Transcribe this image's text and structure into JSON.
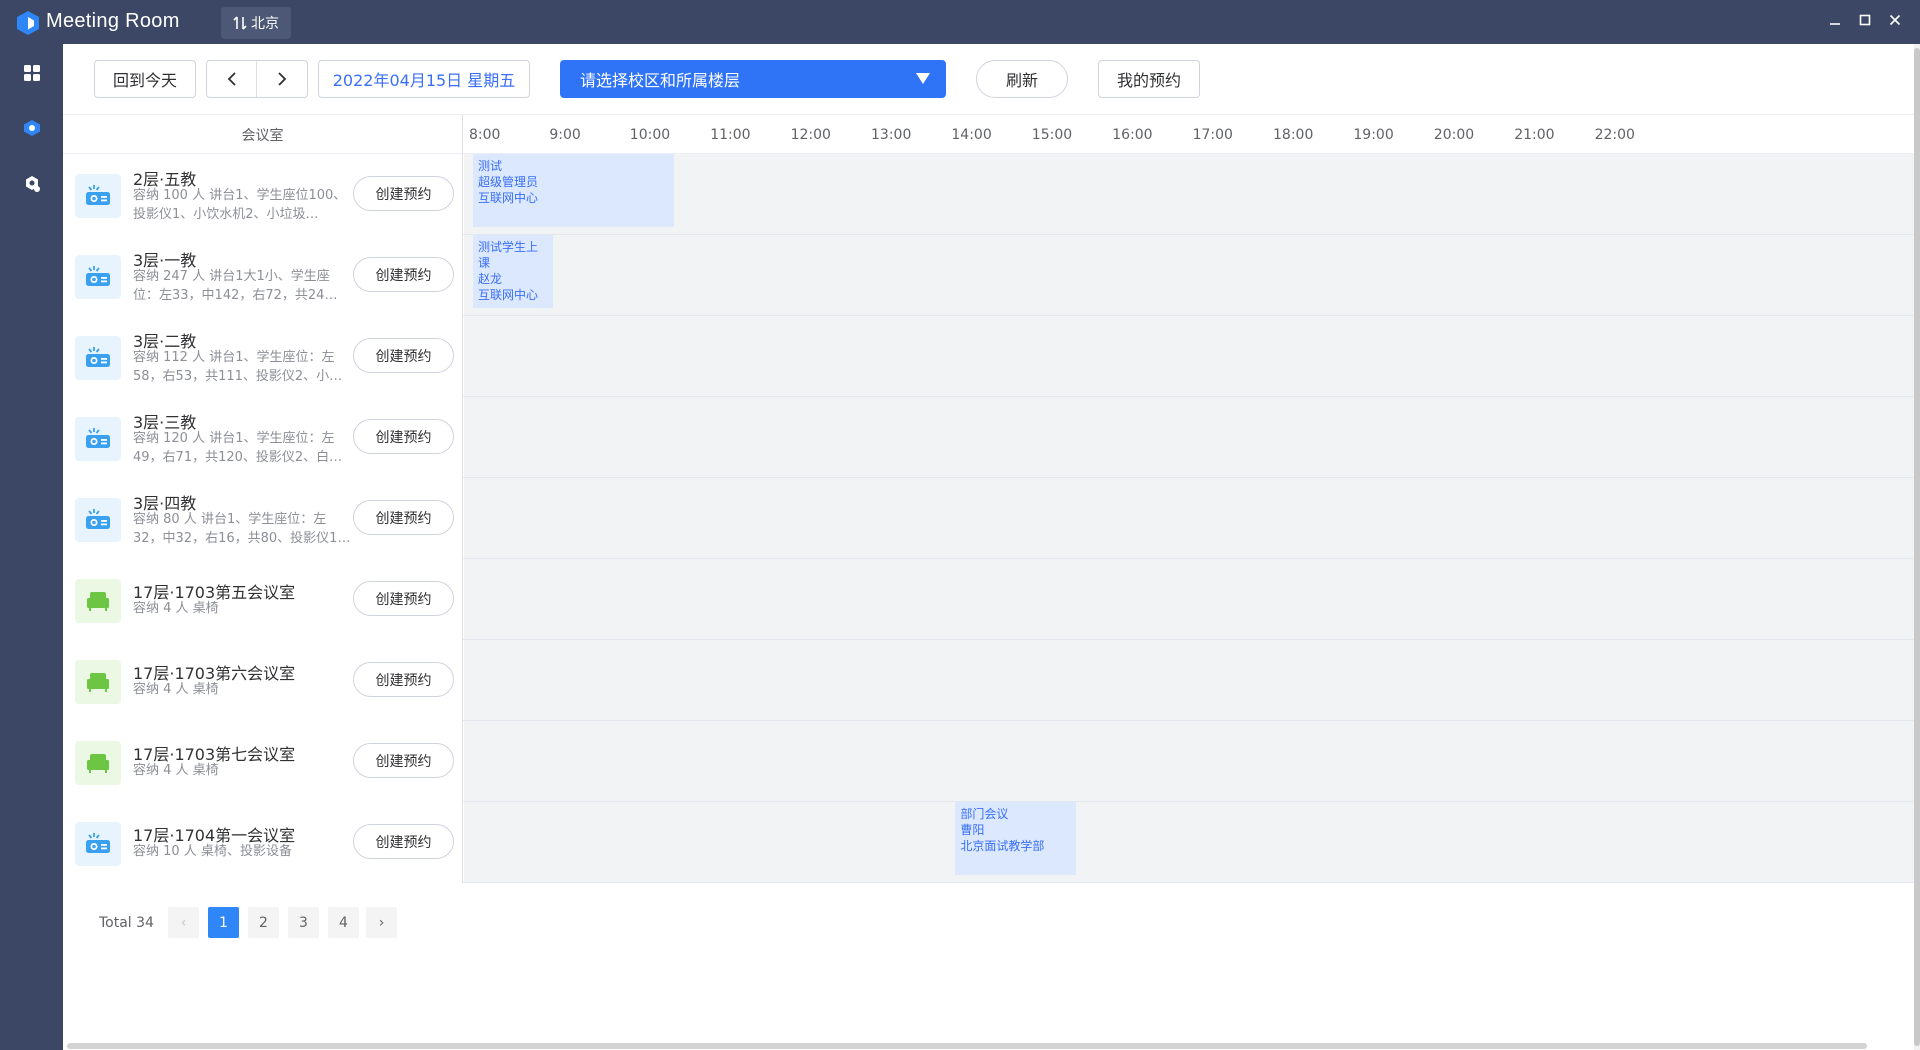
{
  "app": {
    "title": "Meeting Room",
    "city": "北京"
  },
  "toolbar": {
    "today_label": "回到今天",
    "prev_icon": "chevron-left-icon",
    "next_icon": "chevron-right-icon",
    "date_label": "2022年04月15日 星期五",
    "campus_placeholder": "请选择校区和所属楼层",
    "refresh_label": "刷新",
    "my_bookings_label": "我的预约"
  },
  "grid": {
    "room_column_header": "会议室",
    "hours": [
      "8:00",
      "9:00",
      "10:00",
      "11:00",
      "12:00",
      "13:00",
      "14:00",
      "15:00",
      "16:00",
      "17:00",
      "18:00",
      "19:00",
      "20:00",
      "21:00",
      "22:00"
    ],
    "create_label": "创建预约",
    "rooms": [
      {
        "name": "2层·五教",
        "desc": "容纳 100 人 讲台1、学生座位100、投影仪1、小饮水机2、小垃圾…",
        "icon": "projector-icon",
        "color": "#3aa0f0",
        "bookings": [
          {
            "start": 8.0,
            "end": 10.5,
            "lines": [
              "测试",
              "超级管理员",
              "互联网中心"
            ]
          }
        ]
      },
      {
        "name": "3层·一教",
        "desc": "容纳 247 人 讲台1大1小、学生座位：左33，中142，右72，共24…",
        "icon": "projector-icon",
        "color": "#3aa0f0",
        "bookings": [
          {
            "start": 8.0,
            "end": 9.0,
            "lines": [
              "测试学生上课",
              "赵龙",
              "互联网中心"
            ]
          }
        ]
      },
      {
        "name": "3层·二教",
        "desc": "容纳 112 人 讲台1、学生座位：左58，右53，共111、投影仪2、小…",
        "icon": "projector-icon",
        "color": "#3aa0f0",
        "bookings": []
      },
      {
        "name": "3层·三教",
        "desc": "容纳 120 人 讲台1、学生座位：左49，右71，共120、投影仪2、白…",
        "icon": "projector-icon",
        "color": "#3aa0f0",
        "bookings": []
      },
      {
        "name": "3层·四教",
        "desc": "容纳 80 人 讲台1、学生座位：左32，中32，右16，共80、投影仪1…",
        "icon": "projector-icon",
        "color": "#3aa0f0",
        "bookings": []
      },
      {
        "name": "17层·1703第五会议室",
        "desc": "容纳 4 人 桌椅",
        "icon": "armchair-icon",
        "color": "#6cc644",
        "bookings": []
      },
      {
        "name": "17层·1703第六会议室",
        "desc": "容纳 4 人 桌椅",
        "icon": "armchair-icon",
        "color": "#6cc644",
        "bookings": []
      },
      {
        "name": "17层·1703第七会议室",
        "desc": "容纳 4 人 桌椅",
        "icon": "armchair-icon",
        "color": "#6cc644",
        "bookings": []
      },
      {
        "name": "17层·1704第一会议室",
        "desc": "容纳 10 人 桌椅、投影设备",
        "icon": "projector-icon",
        "color": "#3aa0f0",
        "bookings": [
          {
            "start": 14.0,
            "end": 15.5,
            "lines": [
              "部门会议",
              "曹阳",
              "北京面试教学部"
            ]
          }
        ]
      }
    ]
  },
  "pagination": {
    "total_label": "Total 34",
    "pages": [
      "1",
      "2",
      "3",
      "4"
    ],
    "current": "1",
    "prev": "‹",
    "next": "›"
  },
  "colors": {
    "accent": "#2f73f7",
    "sidebar": "#3b4764",
    "booking_bg": "#dbe8fd",
    "booking_text": "#3a6ff7"
  }
}
